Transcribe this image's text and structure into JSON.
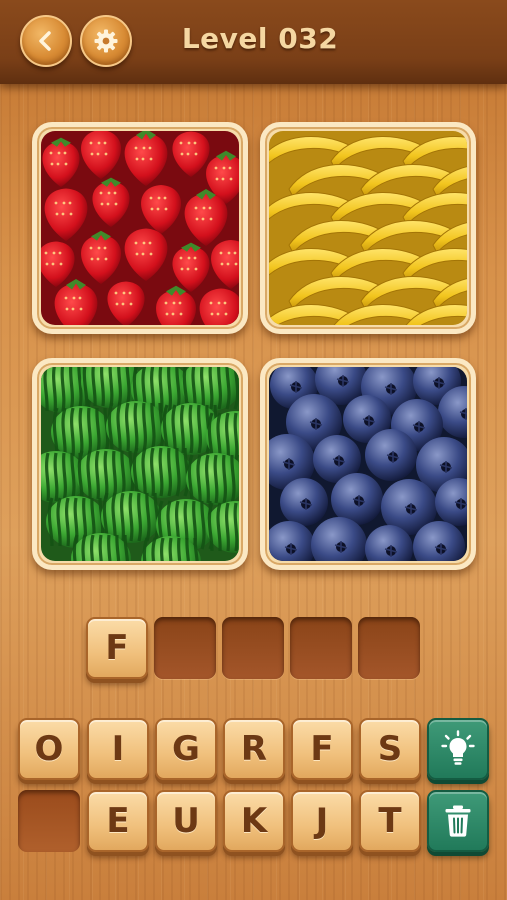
{
  "header": {
    "title": "Level 032",
    "back_icon": "chevron-left-icon",
    "settings_icon": "gear-icon"
  },
  "photos": [
    {
      "subject": "strawberries"
    },
    {
      "subject": "bananas"
    },
    {
      "subject": "watermelons"
    },
    {
      "subject": "blueberries"
    }
  ],
  "answer_slots": [
    "F",
    "",
    "",
    "",
    ""
  ],
  "letter_rows": [
    [
      "O",
      "I",
      "G",
      "R",
      "F",
      "S"
    ],
    [
      "",
      "E",
      "U",
      "K",
      "J",
      "T"
    ]
  ],
  "actions": {
    "hint_icon": "lightbulb-icon",
    "delete_icon": "trash-icon"
  },
  "colors": {
    "wood": "#d7914a",
    "header": "#7a3f17",
    "tile": "#f0c07c",
    "tile_text": "#6d3914",
    "action_button": "#217a5a"
  }
}
